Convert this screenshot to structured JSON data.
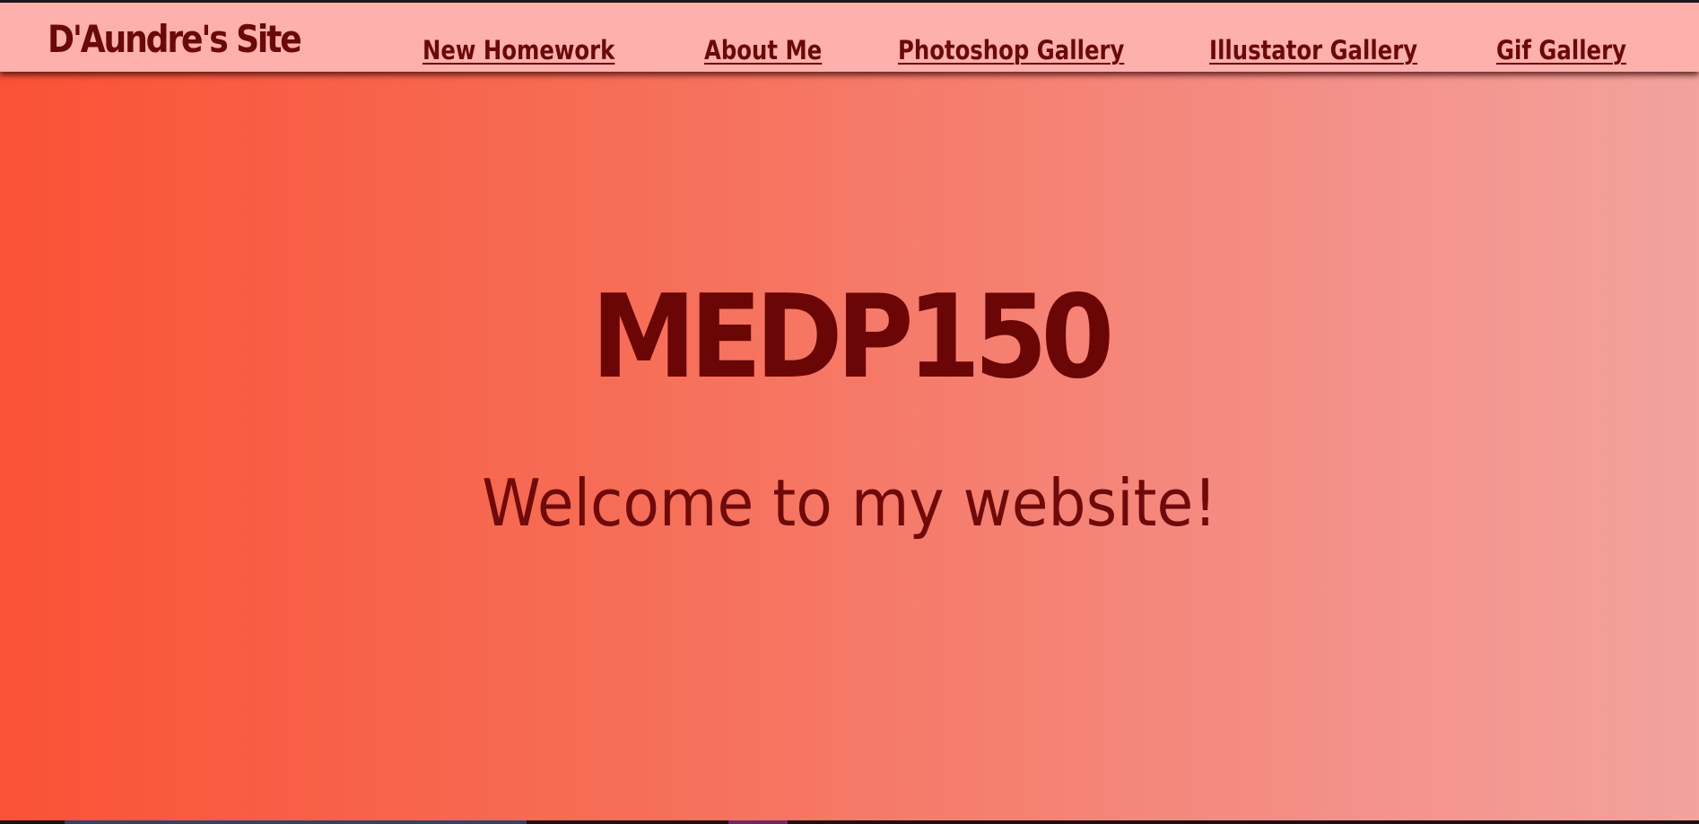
{
  "site": {
    "logo_text": "D'Aundre's Site"
  },
  "nav": {
    "items": [
      {
        "label": "New Homework"
      },
      {
        "label": "About Me"
      },
      {
        "label": "Photoshop Gallery"
      },
      {
        "label": "Illustator Gallery"
      },
      {
        "label": "Gif Gallery"
      }
    ]
  },
  "hero": {
    "title": "MEDP150",
    "subtitle": "Welcome to my website!"
  },
  "colors": {
    "nav_background": "#feb0ad",
    "text_primary": "#6b0808",
    "gradient_start": "#fa5236",
    "gradient_end": "#f2a39c"
  }
}
